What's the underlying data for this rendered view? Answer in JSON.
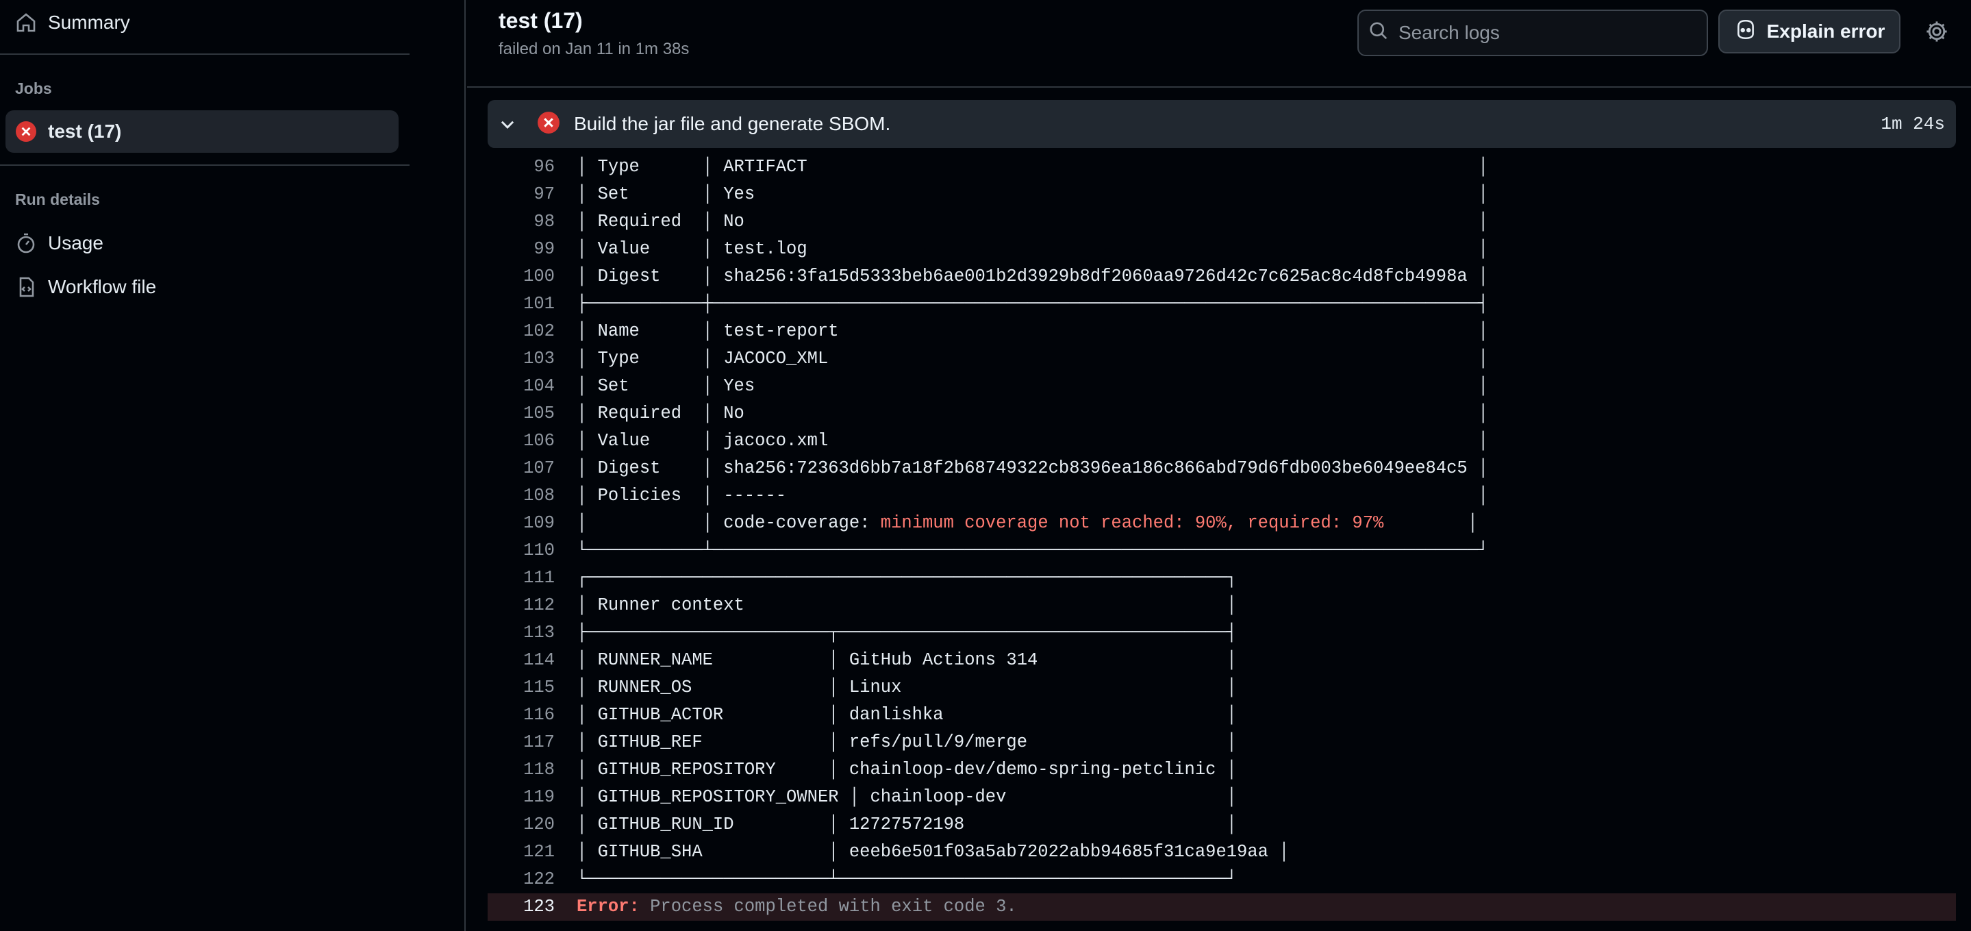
{
  "sidebar": {
    "summary_label": "Summary",
    "jobs_heading": "Jobs",
    "job_label": "test (17)",
    "run_details_heading": "Run details",
    "usage_label": "Usage",
    "workflow_label": "Workflow file"
  },
  "header": {
    "title": "test (17)",
    "subtitle": "failed on Jan 11 in 1m 38s",
    "search_placeholder": "Search logs",
    "explain_label": "Explain error"
  },
  "step": {
    "name": "Build the jar file and generate SBOM.",
    "duration": "1m 24s"
  },
  "colors": {
    "error": "#da3633",
    "highlight": "#ff7b72",
    "background": "#010409"
  },
  "log": {
    "lines": [
      {
        "n": "96",
        "t": "│ Type      │ ARTIFACT                                                                │"
      },
      {
        "n": "97",
        "t": "│ Set       │ Yes                                                                     │"
      },
      {
        "n": "98",
        "t": "│ Required  │ No                                                                      │"
      },
      {
        "n": "99",
        "t": "│ Value     │ test.log                                                                │"
      },
      {
        "n": "100",
        "t": "│ Digest    │ sha256:3fa15d5333beb6ae001b2d3929b8df2060aa9726d42c7c625ac8c4d8fcb4998a │"
      },
      {
        "n": "101",
        "t": "├───────────┼─────────────────────────────────────────────────────────────────────────┤"
      },
      {
        "n": "102",
        "t": "│ Name      │ test-report                                                             │"
      },
      {
        "n": "103",
        "t": "│ Type      │ JACOCO_XML                                                              │"
      },
      {
        "n": "104",
        "t": "│ Set       │ Yes                                                                     │"
      },
      {
        "n": "105",
        "t": "│ Required  │ No                                                                      │"
      },
      {
        "n": "106",
        "t": "│ Value     │ jacoco.xml                                                              │"
      },
      {
        "n": "107",
        "t": "│ Digest    │ sha256:72363d6bb7a18f2b68749322cb8396ea186c866abd79d6fdb003be6049ee84c5 │"
      },
      {
        "n": "108",
        "t": "│ Policies  │ ------                                                                  │"
      },
      {
        "n": "109",
        "t": "│           │ code-coverage: ",
        "h": "minimum coverage not reached: 90%, required: 97%",
        "t2": "        │"
      },
      {
        "n": "110",
        "t": "└───────────┴─────────────────────────────────────────────────────────────────────────┘"
      },
      {
        "n": "111",
        "t": "┌─────────────────────────────────────────────────────────────┐"
      },
      {
        "n": "112",
        "t": "│ Runner context                                              │"
      },
      {
        "n": "113",
        "t": "├───────────────────────┬─────────────────────────────────────┤"
      },
      {
        "n": "114",
        "t": "│ RUNNER_NAME           │ GitHub Actions 314                  │"
      },
      {
        "n": "115",
        "t": "│ RUNNER_OS             │ Linux                               │"
      },
      {
        "n": "116",
        "t": "│ GITHUB_ACTOR          │ danlishka                           │"
      },
      {
        "n": "117",
        "t": "│ GITHUB_REF            │ refs/pull/9/merge                   │"
      },
      {
        "n": "118",
        "t": "│ GITHUB_REPOSITORY     │ chainloop-dev/demo-spring-petclinic │"
      },
      {
        "n": "119",
        "t": "│ GITHUB_REPOSITORY_OWNER │ chainloop-dev                     │"
      },
      {
        "n": "120",
        "t": "│ GITHUB_RUN_ID         │ 12727572198                         │"
      },
      {
        "n": "121",
        "t": "│ GITHUB_SHA            │ eeeb6e501f03a5ab72022abb94685f31ca9e19aa │"
      },
      {
        "n": "122",
        "t": "└───────────────────────┴─────────────────────────────────────┘"
      }
    ],
    "error_line": {
      "n": "123",
      "label": "Error:",
      "message": " Process completed with exit code 3."
    }
  }
}
